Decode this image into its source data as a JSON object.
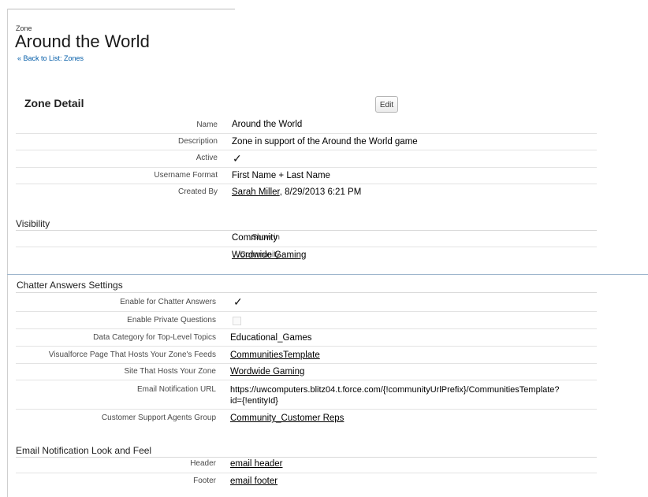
{
  "header": {
    "crumb": "Zone",
    "title": "Around the World",
    "back_link": "« Back to List: Zones"
  },
  "zone_detail": {
    "title": "Zone Detail",
    "edit_label": "Edit",
    "name_label": "Name",
    "name_value": "Around the World",
    "description_label": "Description",
    "description_value": "Zone in support of the Around the World game",
    "active_label": "Active",
    "active_check": "✓",
    "username_label": "Username Format",
    "username_value": "First Name + Last Name",
    "created_label": "Created By",
    "created_user": "Sarah Miller",
    "created_date": ", 8/29/2013 6:21 PM"
  },
  "visibility": {
    "title": "Visibility",
    "showin_label": "Show in",
    "showin_value": "Community",
    "community_label": "Community",
    "community_value": "Wordwide Gaming"
  },
  "chatter": {
    "title": "Chatter Answers Settings",
    "enable_label": "Enable for Chatter Answers",
    "enable_check": "✓",
    "private_label": "Enable Private Questions",
    "datacat_label": "Data Category for Top-Level Topics",
    "datacat_value": "Educational_Games",
    "vfpage_label": "Visualforce Page That Hosts Your Zone's Feeds",
    "vfpage_value": "CommunitiesTemplate",
    "site_label": "Site That Hosts Your Zone",
    "site_value": "Wordwide Gaming",
    "emailurl_label": "Email Notification URL",
    "emailurl_value1": "https://uwcomputers.blitz04.t.force.com/{!communityUrlPrefix}/CommunitiesTemplate?",
    "emailurl_value2": "id={!entityId}",
    "agents_label": "Customer Support Agents Group",
    "agents_value": "Community_Customer Reps"
  },
  "email_look": {
    "title": "Email Notification Look and Feel",
    "header_label": "Header",
    "header_value": "email header",
    "footer_label": "Footer",
    "footer_value": "email footer"
  }
}
